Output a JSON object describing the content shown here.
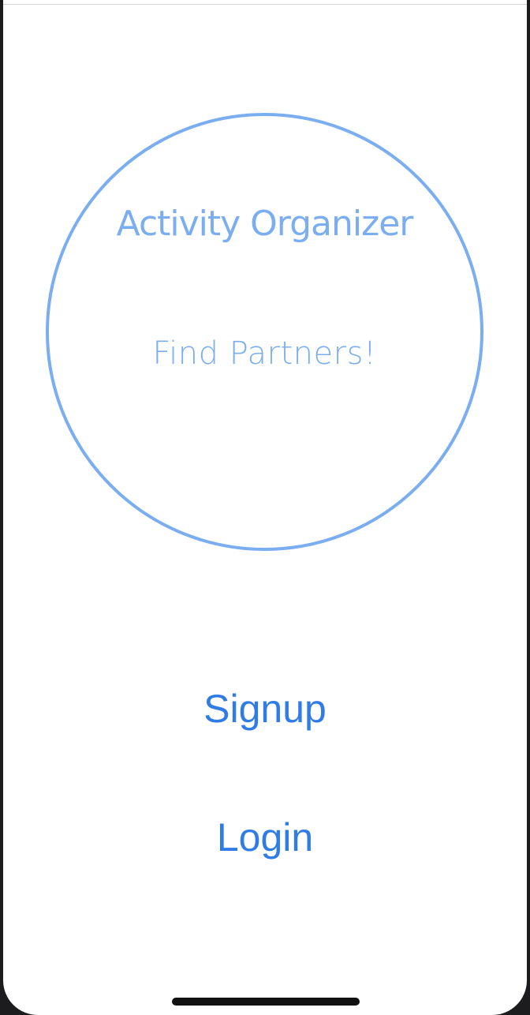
{
  "app": {
    "title": "Activity Organizer",
    "tagline": "Find Partners!"
  },
  "actions": {
    "signup_label": "Signup",
    "login_label": "Login"
  },
  "colors": {
    "brand_light": "#7aaef0",
    "link_blue": "#2f7ce6",
    "background": "#ffffff"
  }
}
